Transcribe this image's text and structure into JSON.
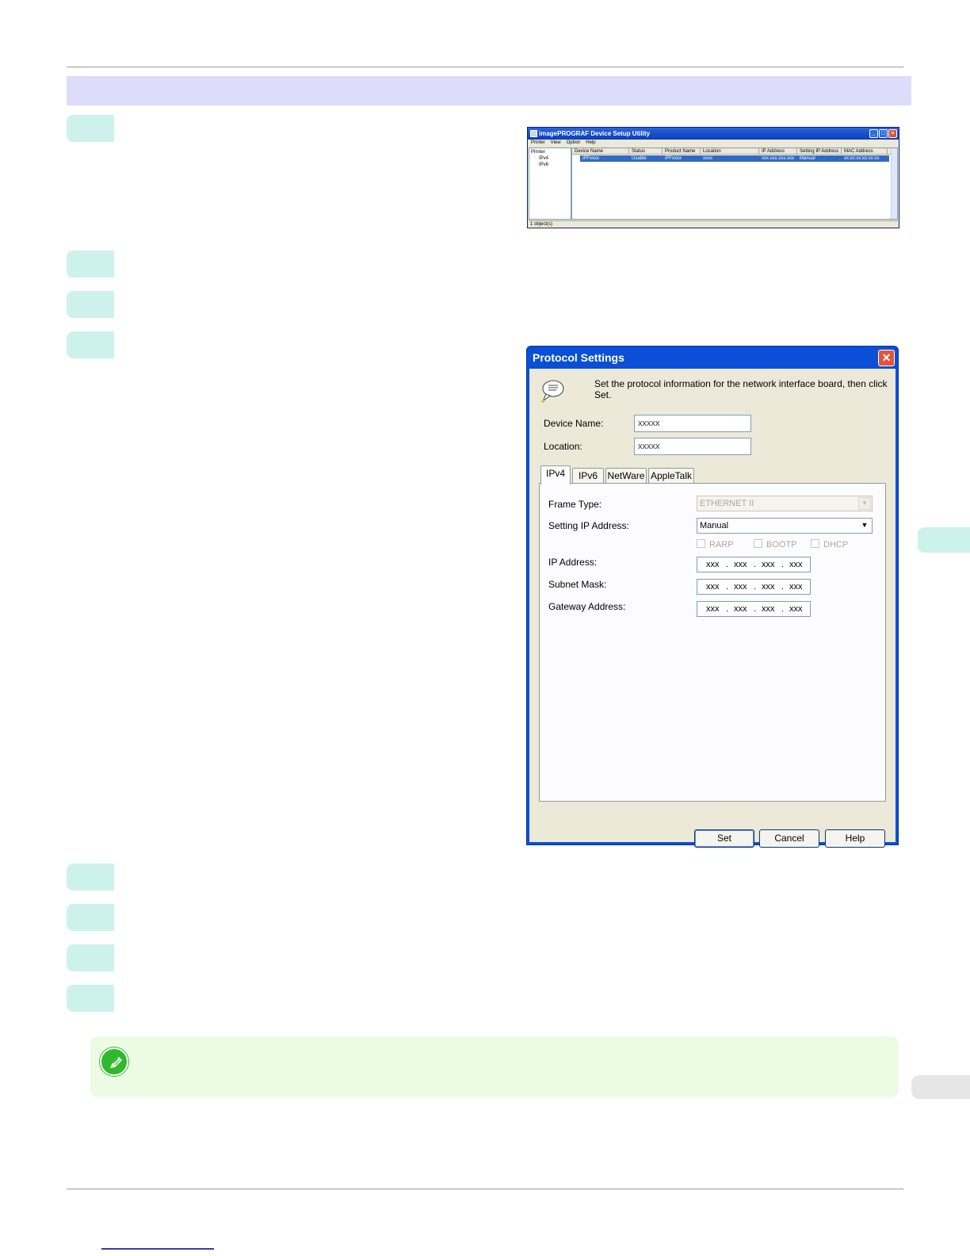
{
  "utility_window": {
    "title": "imagePROGRAF Device Setup Utility",
    "menu": [
      "Printer",
      "View",
      "Option",
      "Help"
    ],
    "tree": [
      "Printer",
      "IPv4",
      "IPv6"
    ],
    "columns": [
      "Device Name",
      "Status",
      "Product Name",
      "Location",
      "IP Address",
      "Setting IP Address",
      "MAC Address"
    ],
    "row": [
      "iPFxxxx",
      "Usable",
      "iPFxxxx",
      "xxxx",
      "xxx.xxx.xxx.xxx",
      "Manual",
      "xx:xx:xx:xx:xx:xx"
    ],
    "status": "1 object(s)"
  },
  "protocol_dialog": {
    "title": "Protocol Settings",
    "close_glyph": "✕",
    "message": "Set the protocol information for the network interface board, then click Set.",
    "device_name_label": "Device Name:",
    "device_name_value": "xxxxx",
    "location_label": "Location:",
    "location_value": "xxxxx",
    "tabs": [
      "IPv4",
      "IPv6",
      "NetWare",
      "AppleTalk"
    ],
    "frame_type_label": "Frame Type:",
    "frame_type_value": "ETHERNET II",
    "setting_ip_label": "Setting IP Address:",
    "setting_ip_value": "Manual",
    "checkboxes": [
      "RARP",
      "BOOTP",
      "DHCP"
    ],
    "ip_address_label": "IP Address:",
    "subnet_mask_label": "Subnet Mask:",
    "gateway_label": "Gateway Address:",
    "ip_octet": "xxx",
    "ip_dot": ".",
    "buttons": {
      "set": "Set",
      "cancel": "Cancel",
      "help": "Help"
    }
  },
  "colors": {
    "section_bar": "#dedcfb",
    "step_tab": "#cdf2ec",
    "note_box": "#ecfce4",
    "note_icon": "#2fba2d",
    "dialog_frame": "#0a4fd6"
  }
}
